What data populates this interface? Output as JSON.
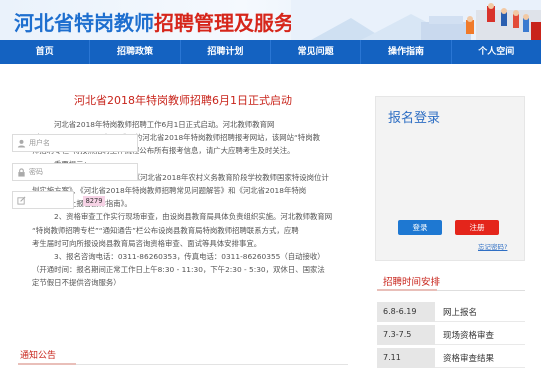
{
  "header": {
    "title_part1": "河北省特岗教师",
    "title_part2": "招聘管理及服务平台"
  },
  "nav": [
    "首页",
    "招聘政策",
    "招聘计划",
    "常见问题",
    "操作指南",
    "个人空间"
  ],
  "article": {
    "title": "河北省2018年特岗教师招聘6月1日正式启动",
    "paragraphs": [
      "河北省2018年特岗教师招聘工作6月1日正式启动。河北教师教育网",
      "（www.hbte.com.cn）是唯一的河北省2018年特岗教师招聘报考网站，该网站“特岗教",
      "师招聘专栏”将按照招聘工作流程公布所有报考信息，请广大应聘考生及时关注。",
      "重要提示：",
      "1、首次报名请认真阅读《河北省2018年农村义务教育阶段学校教师国家特设岗位计",
      "划实施方案》、《河北省2018年特岗教师招聘常见问题解答》和《河北省2018年特岗",
      "教师招聘网上报名操作指南》。",
      "2、资格审查工作实行现场审查，由设岗县教育局具体负责组织实施。河北教师教育网",
      "“特岗教师招聘专栏”“通知通告”栏公布设岗县教育局特岗教师招聘联系方式，应聘",
      "考生届时可向所报设岗县教育局咨询资格审查、面试等具体安排事宜。",
      "3、报名咨询电话：0311-86260353，传真电话：0311-86260355（自动接收）",
      "（开通时间：报名期间正常工作日上午8:30 - 11:30，下午2:30 - 5:30，双休日、国家法",
      "定节假日不提供咨询服务）"
    ]
  },
  "notice": {
    "label": "通知公告"
  },
  "login": {
    "title": "报名登录",
    "username_placeholder": "用户名",
    "password_placeholder": "密码",
    "code_placeholder": "",
    "captcha": "8279",
    "login_button": "登录",
    "register_button": "注册",
    "forgot_link": "忘记密码?"
  },
  "schedule": {
    "title": "招聘时间安排",
    "rows": [
      {
        "date": "6.8-6.19",
        "event": "网上报名"
      },
      {
        "date": "7.3-7.5",
        "event": "现场资格审查"
      },
      {
        "date": "7.11",
        "event": "资格审查结果"
      }
    ]
  }
}
